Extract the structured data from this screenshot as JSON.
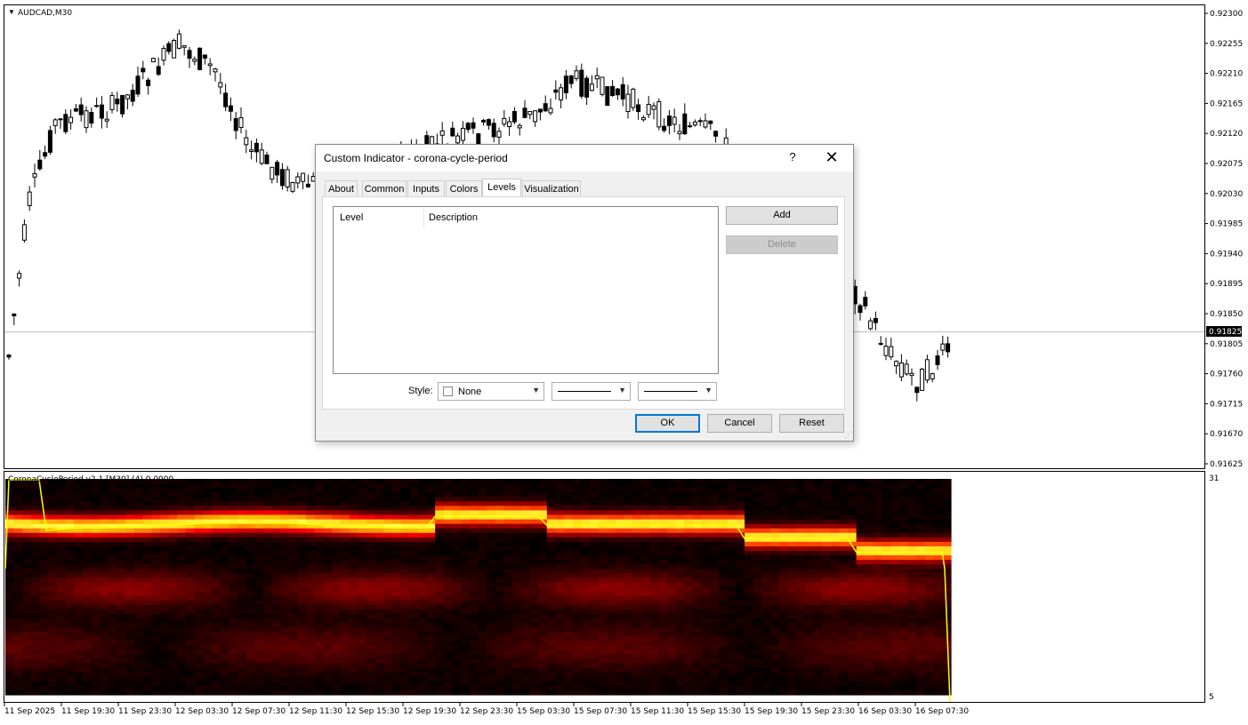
{
  "chart": {
    "symbol_label": "AUDCAD,M30",
    "indicator_label": "CoronaCyclePeriod v2.1 [M30] (4) 0.0000",
    "price_ticks": [
      "0.92300",
      "0.92255",
      "0.92210",
      "0.92165",
      "0.92120",
      "0.92075",
      "0.92030",
      "0.91985",
      "0.91940",
      "0.91895",
      "0.91850",
      "0.91805",
      "0.91760",
      "0.91715",
      "0.91670",
      "0.91625"
    ],
    "current_price": "0.91825",
    "indicator_ticks": [
      "31",
      "5"
    ],
    "time_ticks": [
      "11 Sep 2025",
      "11 Sep 19:30",
      "11 Sep 23:30",
      "12 Sep 03:30",
      "12 Sep 07:30",
      "12 Sep 11:30",
      "12 Sep 15:30",
      "12 Sep 19:30",
      "12 Sep 23:30",
      "15 Sep 03:30",
      "15 Sep 07:30",
      "15 Sep 11:30",
      "15 Sep 15:30",
      "15 Sep 19:30",
      "15 Sep 23:30",
      "16 Sep 03:30",
      "16 Sep 07:30"
    ],
    "colors": {
      "bull": "#ffffff",
      "bear": "#000000",
      "line": "#ffff00",
      "heat_low": "#000000",
      "heat_high": "#ffff40"
    }
  },
  "dialog": {
    "title": "Custom Indicator - corona-cycle-period",
    "help": "?",
    "close": "✕",
    "tabs": [
      "About",
      "Common",
      "Inputs",
      "Colors",
      "Levels",
      "Visualization"
    ],
    "active_tab": "Levels",
    "columns": [
      "Level",
      "Description"
    ],
    "add_label": "Add",
    "delete_label": "Delete",
    "style_label": "Style:",
    "color_value": "None",
    "ok_label": "OK",
    "cancel_label": "Cancel",
    "reset_label": "Reset"
  }
}
